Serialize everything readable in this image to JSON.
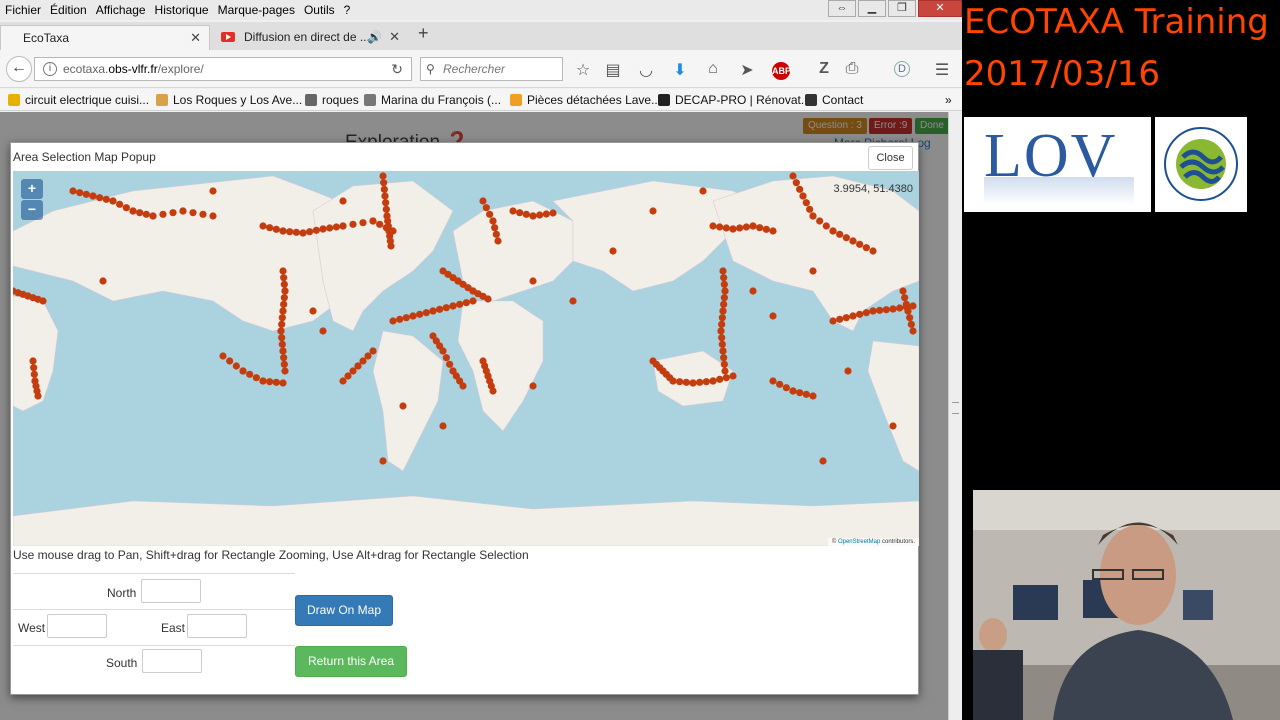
{
  "menubar": {
    "items": [
      "Fichier",
      "Édition",
      "Affichage",
      "Historique",
      "Marque-pages",
      "Outils",
      "?"
    ]
  },
  "tabs": {
    "active_label": "EcoTaxa",
    "second_label": "Diffusion en direct de ..."
  },
  "navbar": {
    "url_prefix": "ecotaxa.",
    "url_domain": "obs-vlfr.fr",
    "url_path": "/explore/",
    "search_placeholder": "Rechercher"
  },
  "bookmarks": [
    {
      "label": "circuit electrique cuisi...",
      "color": "#e8b000"
    },
    {
      "label": "Los Roques y Los Ave...",
      "color": "#d7a24a"
    },
    {
      "label": "roques",
      "color": "#666666"
    },
    {
      "label": "Marina du François (...",
      "color": "#777777"
    },
    {
      "label": "Pièces détachées Lave...",
      "color": "#f0a020"
    },
    {
      "label": "DECAP-PRO | Rénovat...",
      "color": "#222222"
    },
    {
      "label": "Contact",
      "color": "#333333"
    }
  ],
  "page": {
    "title": "Exploration",
    "badge_question": "Question : 3",
    "badge_error": "Error :9",
    "badge_done": "Done",
    "user_link": "Marc Picheral  Log out"
  },
  "modal": {
    "title": "Area Selection Map Popup",
    "close_label": "Close",
    "coords_readout": "3.9954, 51.4380",
    "zoom_in": "+",
    "zoom_out": "−",
    "attribution_prefix": "© ",
    "attribution_link": "OpenStreetMap",
    "attribution_suffix": " contributors.",
    "instructions": "Use mouse drag to Pan, Shift+drag for Rectangle Zooming, Use Alt+drag for Rectangle Selection",
    "north_label": "North",
    "west_label": "West",
    "east_label": "East",
    "south_label": "South",
    "north_value": "",
    "west_value": "",
    "east_value": "",
    "south_value": "",
    "draw_button": "Draw On Map",
    "return_button": "Return this Area"
  },
  "video_overlay": {
    "title_line1": "ECOTAXA Training",
    "title_line2": "2017/03/16",
    "lov_logo_text": "LOV",
    "obs_logo_text": "OBSERVATOIRE OCEANOLOGIQUE · VILLEFRANCHE/MER"
  },
  "colors": {
    "sample_points": "#c43d0f",
    "ocean": "#aad3df",
    "land": "#f2efe9",
    "title_orange": "#ff4500",
    "primary_button": "#337ab7",
    "success_button": "#5cb85c"
  }
}
